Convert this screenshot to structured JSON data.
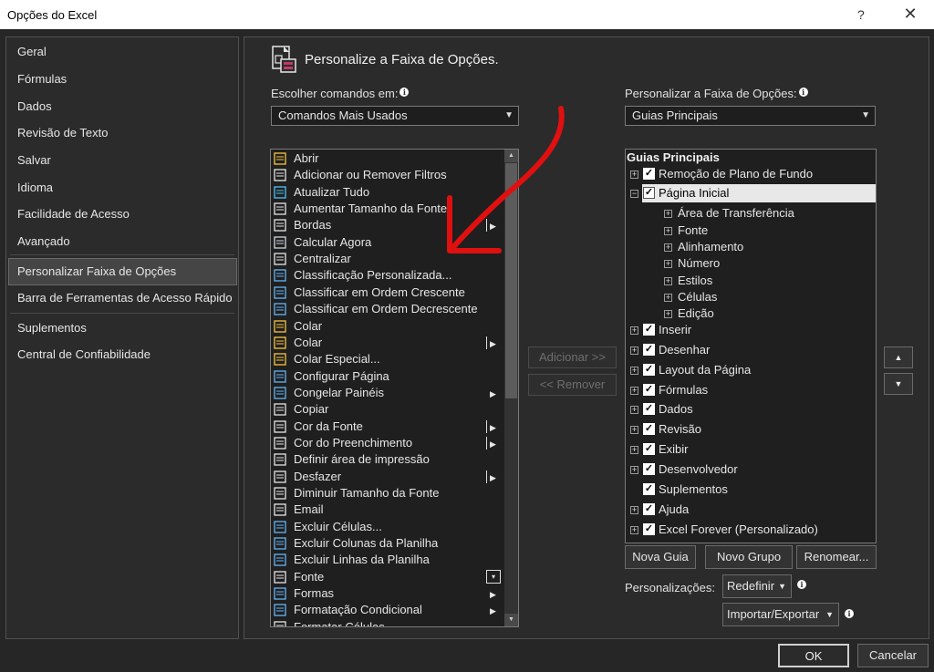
{
  "window": {
    "title": "Opções do Excel",
    "help_label": "?",
    "close_label": "✕"
  },
  "left_nav": {
    "items": [
      {
        "label": "Geral"
      },
      {
        "label": "Fórmulas"
      },
      {
        "label": "Dados"
      },
      {
        "label": "Revisão de Texto"
      },
      {
        "label": "Salvar"
      },
      {
        "label": "Idioma"
      },
      {
        "label": "Facilidade de Acesso"
      },
      {
        "label": "Avançado"
      },
      {
        "label": "Personalizar Faixa de Opções",
        "selected": true
      },
      {
        "label": "Barra de Ferramentas de Acesso Rápido"
      },
      {
        "label": "Suplementos"
      },
      {
        "label": "Central de Confiabilidade"
      }
    ]
  },
  "main": {
    "header_title": "Personalize a Faixa de Opções.",
    "choose_commands": {
      "label": "Escolher comandos em:",
      "value": "Comandos Mais Usados"
    },
    "customize_ribbon": {
      "label": "Personalizar a Faixa de Opções:",
      "value": "Guias Principais"
    },
    "commands": [
      {
        "label": "Abrir",
        "icon": "folder-open-icon",
        "submenu": false
      },
      {
        "label": "Adicionar ou Remover Filtros",
        "icon": "filter-icon",
        "submenu": false
      },
      {
        "label": "Atualizar Tudo",
        "icon": "refresh-all-icon",
        "submenu": false
      },
      {
        "label": "Aumentar Tamanho da Fonte",
        "icon": "font-grow-icon",
        "submenu": false
      },
      {
        "label": "Bordas",
        "icon": "borders-icon",
        "submenu": true,
        "split": true
      },
      {
        "label": "Calcular Agora",
        "icon": "calculator-icon",
        "submenu": false
      },
      {
        "label": "Centralizar",
        "icon": "align-center-icon",
        "submenu": false
      },
      {
        "label": "Classificação Personalizada...",
        "icon": "custom-sort-icon",
        "submenu": false
      },
      {
        "label": "Classificar em Ordem Crescente",
        "icon": "sort-ascending-icon",
        "submenu": false
      },
      {
        "label": "Classificar em Ordem Decrescente",
        "icon": "sort-descending-icon",
        "submenu": false
      },
      {
        "label": "Colar",
        "icon": "paste-icon",
        "submenu": false
      },
      {
        "label": "Colar",
        "icon": "paste-icon",
        "submenu": true,
        "split": true
      },
      {
        "label": "Colar Especial...",
        "icon": "paste-special-icon",
        "submenu": false
      },
      {
        "label": "Configurar Página",
        "icon": "page-setup-icon",
        "submenu": false
      },
      {
        "label": "Congelar Painéis",
        "icon": "freeze-panes-icon",
        "submenu": true,
        "split": false
      },
      {
        "label": "Copiar",
        "icon": "copy-icon",
        "submenu": false
      },
      {
        "label": "Cor da Fonte",
        "icon": "font-color-icon",
        "submenu": true,
        "split": true
      },
      {
        "label": "Cor do Preenchimento",
        "icon": "fill-color-icon",
        "submenu": true,
        "split": true
      },
      {
        "label": "Definir área de impressão",
        "icon": "print-area-icon",
        "submenu": false
      },
      {
        "label": "Desfazer",
        "icon": "undo-icon",
        "submenu": true,
        "split": true
      },
      {
        "label": "Diminuir Tamanho da Fonte",
        "icon": "font-shrink-icon",
        "submenu": false
      },
      {
        "label": "Email",
        "icon": "email-icon",
        "submenu": false
      },
      {
        "label": "Excluir Células...",
        "icon": "delete-cells-icon",
        "submenu": false
      },
      {
        "label": "Excluir Colunas da Planilha",
        "icon": "delete-columns-icon",
        "submenu": false
      },
      {
        "label": "Excluir Linhas da Planilha",
        "icon": "delete-rows-icon",
        "submenu": false
      },
      {
        "label": "Fonte",
        "icon": "font-icon",
        "submenu": false,
        "combo": true
      },
      {
        "label": "Formas",
        "icon": "shapes-icon",
        "submenu": true,
        "split": false
      },
      {
        "label": "Formatação Condicional",
        "icon": "conditional-format-icon",
        "submenu": true,
        "split": false
      },
      {
        "label": "Formatar Células",
        "icon": "format-cells-icon",
        "submenu": false
      }
    ],
    "add_button": "Adicionar >>",
    "remove_button": "<< Remover",
    "tree_header": "Guias Principais",
    "tree": [
      {
        "label": "Remoção de Plano de Fundo",
        "level": 0,
        "expander": "+",
        "checked": true
      },
      {
        "label": "Página Inicial",
        "level": 0,
        "expander": "−",
        "checked": true,
        "selected": true
      },
      {
        "label": "Área de Transferência",
        "level": 1,
        "expander": "+"
      },
      {
        "label": "Fonte",
        "level": 1,
        "expander": "+"
      },
      {
        "label": "Alinhamento",
        "level": 1,
        "expander": "+"
      },
      {
        "label": "Número",
        "level": 1,
        "expander": "+"
      },
      {
        "label": "Estilos",
        "level": 1,
        "expander": "+"
      },
      {
        "label": "Células",
        "level": 1,
        "expander": "+"
      },
      {
        "label": "Edição",
        "level": 1,
        "expander": "+"
      },
      {
        "label": "Inserir",
        "level": 0,
        "expander": "+",
        "checked": true
      },
      {
        "label": "Desenhar",
        "level": 0,
        "expander": "+",
        "checked": true
      },
      {
        "label": "Layout da Página",
        "level": 0,
        "expander": "+",
        "checked": true
      },
      {
        "label": "Fórmulas",
        "level": 0,
        "expander": "+",
        "checked": true
      },
      {
        "label": "Dados",
        "level": 0,
        "expander": "+",
        "checked": true
      },
      {
        "label": "Revisão",
        "level": 0,
        "expander": "+",
        "checked": true
      },
      {
        "label": "Exibir",
        "level": 0,
        "expander": "+",
        "checked": true
      },
      {
        "label": "Desenvolvedor",
        "level": 0,
        "expander": "+",
        "checked": true
      },
      {
        "label": "Suplementos",
        "level": 0,
        "expander": "",
        "checked": true
      },
      {
        "label": "Ajuda",
        "level": 0,
        "expander": "+",
        "checked": true
      },
      {
        "label": "Excel Forever (Personalizado)",
        "level": 0,
        "expander": "+",
        "checked": true
      }
    ],
    "new_tab_button": "Nova Guia",
    "new_group_button": "Novo Grupo",
    "rename_button": "Renomear...",
    "customizations_label": "Personalizações:",
    "reset_button": "Redefinir",
    "import_export_button": "Importar/Exportar"
  },
  "footer": {
    "ok_button": "OK",
    "cancel_button": "Cancelar"
  },
  "colors": {
    "annotation_arrow": "#e01010"
  }
}
